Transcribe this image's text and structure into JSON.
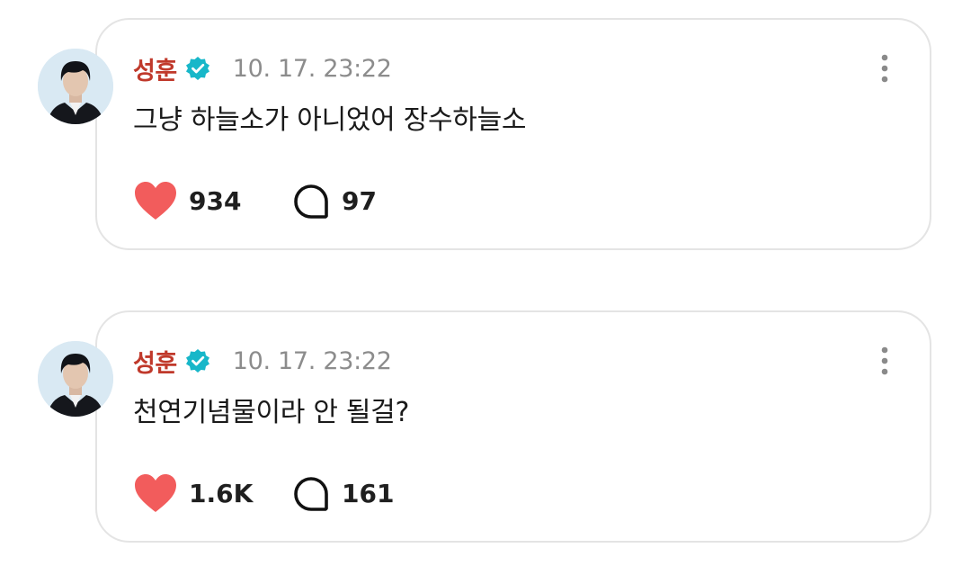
{
  "posts": [
    {
      "author": "성훈",
      "verified": true,
      "timestamp": "10. 17. 23:22",
      "text": "그냥 하늘소가 아니었어 장수하늘소",
      "likes": "934",
      "comments": "97"
    },
    {
      "author": "성훈",
      "verified": true,
      "timestamp": "10. 17. 23:22",
      "text": "천연기념물이라 안 될걸?",
      "likes": "1.6K",
      "comments": "161"
    }
  ],
  "colors": {
    "author": "#c0392b",
    "verified_badge": "#17b7c9",
    "heart": "#f25c5c",
    "timestamp": "#8c8c8c",
    "card_border": "#e4e4e4"
  },
  "icons": {
    "verified": "verified-badge-icon",
    "more": "more-vertical-icon",
    "like": "heart-icon",
    "comment": "comment-bubble-icon"
  }
}
